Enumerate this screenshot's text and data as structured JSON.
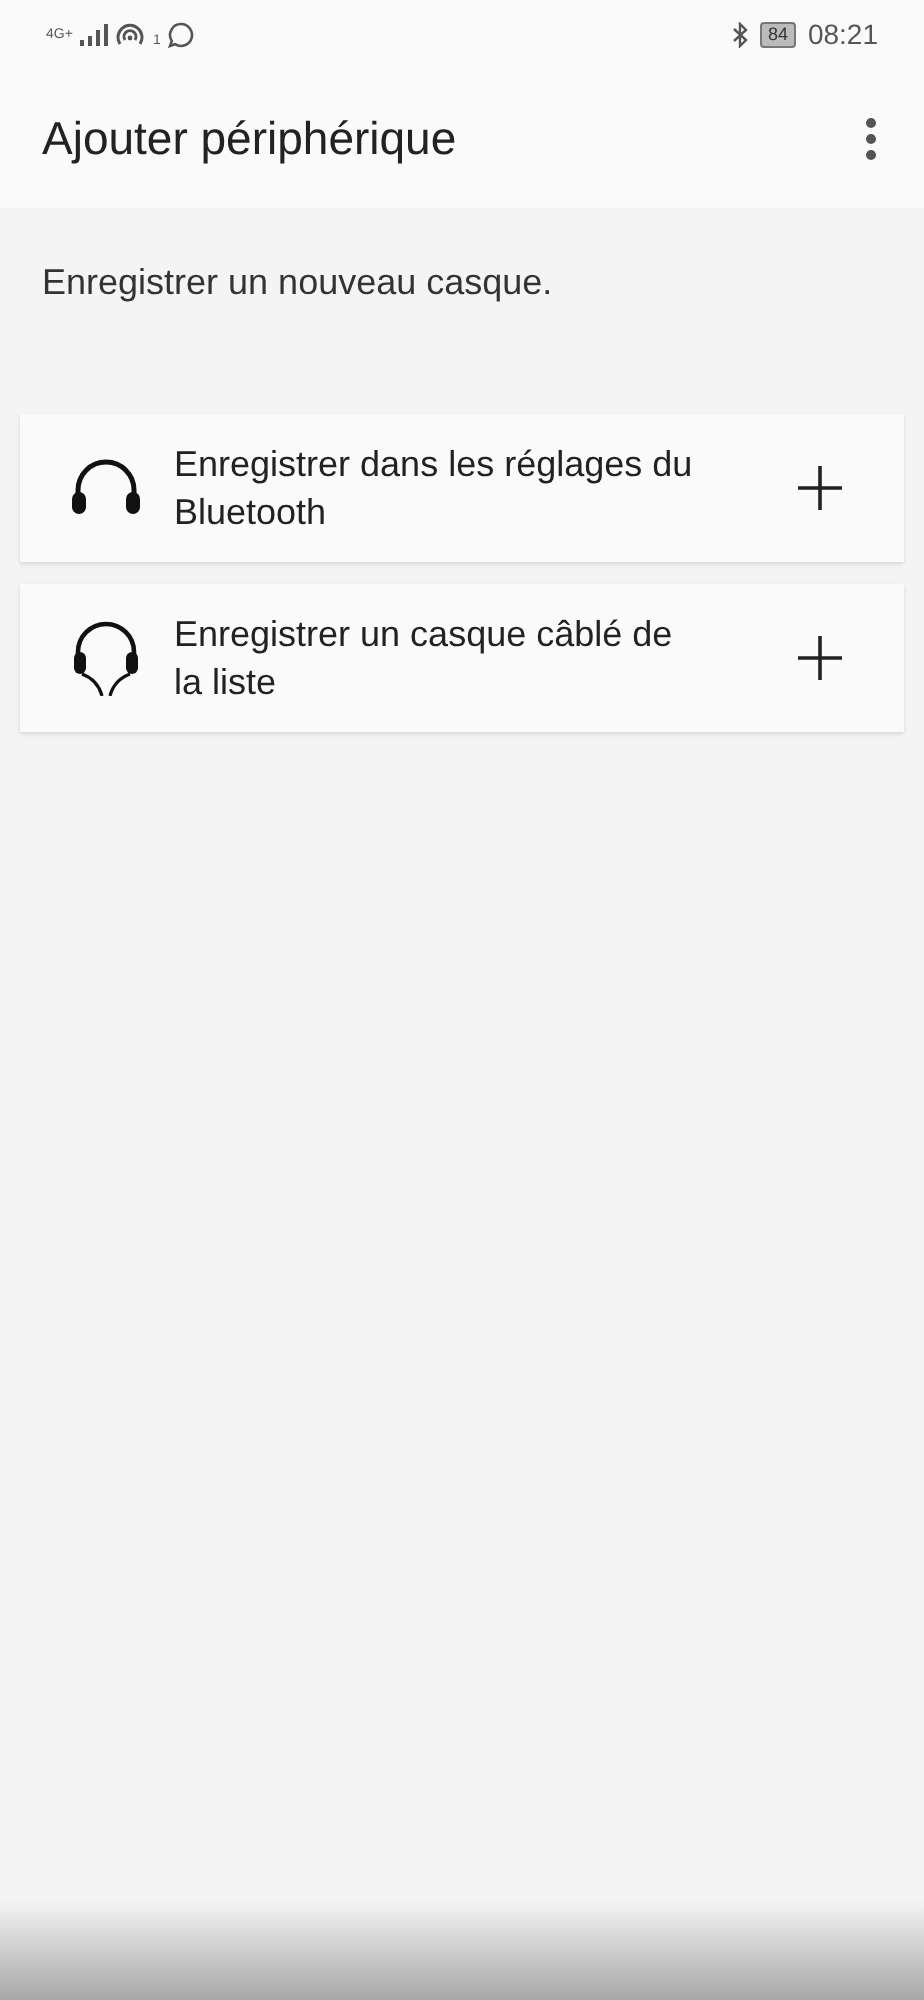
{
  "status_bar": {
    "network": "4G+",
    "hotspot_count": "1",
    "battery": "84",
    "time": "08:21"
  },
  "app_bar": {
    "title": "Ajouter périphérique"
  },
  "intro": "Enregistrer un nouveau casque.",
  "options": [
    {
      "kind": "bluetooth",
      "label": "Enregistrer dans les réglages du Bluetooth"
    },
    {
      "kind": "wired",
      "label": "Enregistrer un casque câblé de la liste"
    }
  ]
}
